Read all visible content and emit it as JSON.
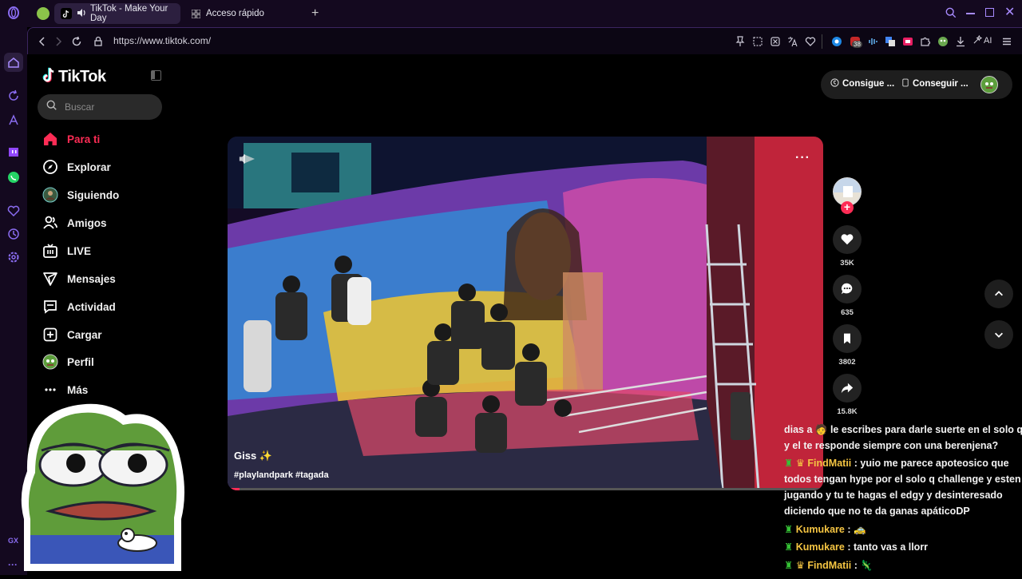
{
  "browser": {
    "tabs": [
      {
        "label": "TikTok - Make Your Day",
        "active": true
      },
      {
        "label": "Acceso rápido",
        "active": false
      }
    ],
    "url": "https://www.tiktok.com/",
    "ext_badge": "38",
    "ai_label": "AI",
    "rail_label": "GX"
  },
  "sidebar": {
    "logo": "TikTok",
    "search_placeholder": "Buscar",
    "items": [
      {
        "label": "Para ti",
        "icon": "home-icon"
      },
      {
        "label": "Explorar",
        "icon": "compass-icon"
      },
      {
        "label": "Siguiendo",
        "icon": "avatar-icon"
      },
      {
        "label": "Amigos",
        "icon": "friends-icon"
      },
      {
        "label": "LIVE",
        "icon": "live-icon"
      },
      {
        "label": "Mensajes",
        "icon": "messages-icon"
      },
      {
        "label": "Actividad",
        "icon": "activity-icon"
      },
      {
        "label": "Cargar",
        "icon": "upload-icon"
      },
      {
        "label": "Perfil",
        "icon": "profile-icon"
      },
      {
        "label": "Más",
        "icon": "more-icon"
      }
    ]
  },
  "topbar": {
    "get_coins": "Consigue ...",
    "get_app": "Conseguir ..."
  },
  "video": {
    "author": "Giss ✨",
    "hashtags": "#playlandpark #tagada",
    "progress": 0.02
  },
  "actions": {
    "likes": "35K",
    "comments": "635",
    "saves": "3802",
    "shares": "15.8K"
  },
  "chat": [
    {
      "user": "",
      "text": "dias a 🧑 le escribes para darle suerte en el solo q y el te responde siempre con una berenjena?"
    },
    {
      "user": "FindMatii",
      "text": ": yuio me parece apoteosico que todos tengan hype por el solo q challenge y esten jugando y tu te hagas el edgy y desinteresado diciendo que no te da ganas apáticoDP"
    },
    {
      "user": "Kumukare",
      "text": ": 🚕"
    },
    {
      "user": "Kumukare",
      "text": ": tanto vas a llorr"
    },
    {
      "user": "FindMatii",
      "text": ": 🦎"
    }
  ],
  "colors": {
    "accent": "#fe2c55",
    "chat_user": "#f5c542",
    "rail_bg": "#14091f",
    "rail_icon": "#8a6cf0"
  }
}
